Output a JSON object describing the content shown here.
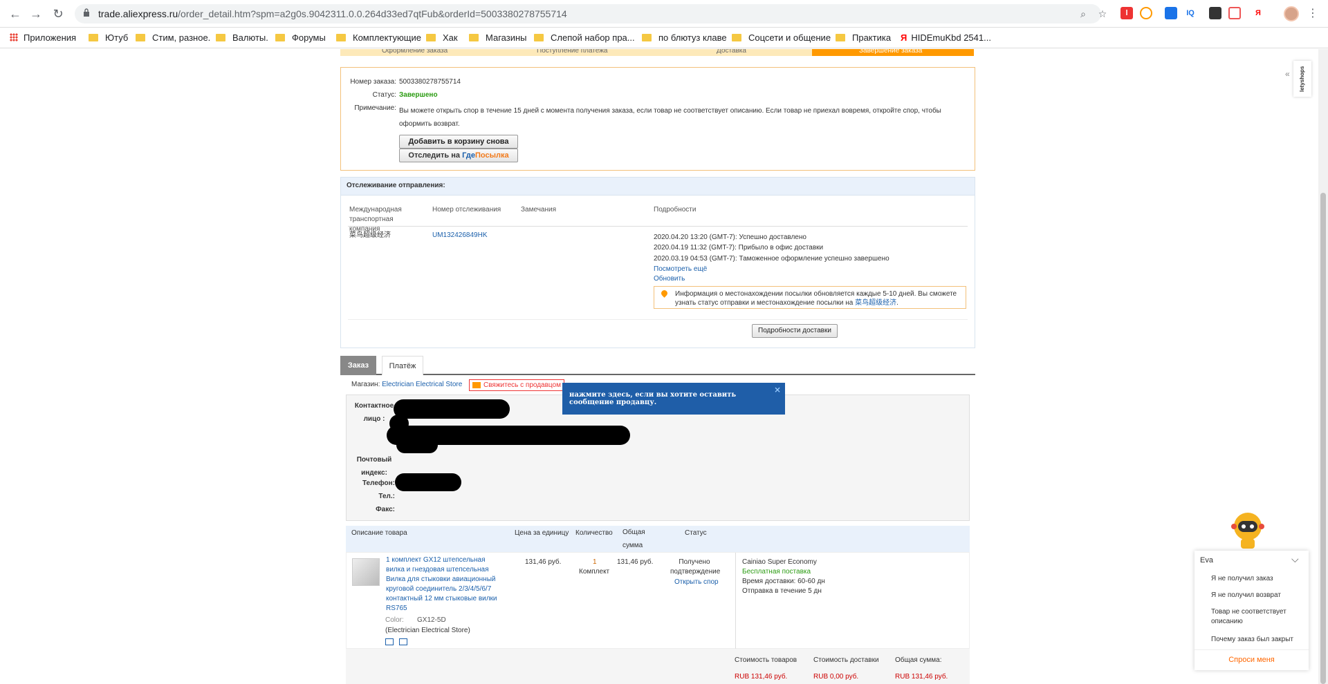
{
  "browser": {
    "url_host": "trade.aliexpress.ru",
    "url_path": "/order_detail.htm?spm=a2g0s.9042311.0.0.264d33ed7qtFub&orderId=5003380278755714",
    "bookmarks": [
      "Приложения",
      "Ютуб",
      "Стим, разное.",
      "Валюты.",
      "Форумы",
      "Комплектующие",
      "Хак",
      "Магазины",
      "Слепой набор пра...",
      "по блютуз клаве",
      "Соцсети и общение",
      "Практика",
      "HIDEmuKbd 2541..."
    ],
    "extensions": [
      "l",
      "IQ",
      "Я"
    ]
  },
  "steps": [
    "Оформление заказа",
    "Поступление платежа",
    "Доставка",
    "Завершение заказа"
  ],
  "order": {
    "number_label": "Номер заказа:",
    "number": "5003380278755714",
    "status_label": "Статус:",
    "status": "Завершено",
    "note_label": "Примечание:",
    "note": "Вы можете открыть спор в течение 15 дней с момента получения заказа, если товар не соответствует описанию. Если товар не приехал вовремя, откройте спор, чтобы оформить возврат.",
    "add_to_cart": "Добавить в корзину снова",
    "track_prefix": "Отследить на ",
    "track_gde": "Где",
    "track_posylka": "Посылка"
  },
  "tracking": {
    "title": "Отслеживание отправления:",
    "col_carrier": "Международная транспортная компания",
    "col_number": "Номер отслеживания",
    "col_notes": "Замечания",
    "col_details": "Подробности",
    "carrier": "菜鸟超级经济",
    "tracking_number": "UM132426849HK",
    "events": [
      "2020.04.20 13:20 (GMT-7): Успешно доставлено",
      "2020.04.19 11:32 (GMT-7): Прибыло в офис доставки",
      "2020.03.19 04:53 (GMT-7): Таможенное оформление успешно завершено"
    ],
    "see_more": "Посмотреть ещё",
    "refresh": "Обновить",
    "info_text": "Информация о местонахождении посылки обновляется каждые 5-10 дней. Вы сможете узнать статус отправки и местонахождение посылки на",
    "info_link": "菜鸟超级经济",
    "details_button": "Подробности доставки"
  },
  "tabs": [
    "Заказ",
    "Платёж"
  ],
  "shop": {
    "label": "Магазин:",
    "name": "Electrician Electrical Store",
    "contact": "Свяжитесь с продавцом",
    "tooltip": "нажмите здесь, если вы хотите оставить сообщение продавцу."
  },
  "address": {
    "contact_label": "Контактное лицо :",
    "zip_label": "Почтовый индекс:",
    "phone_label": "Телефон:",
    "tel_label": "Тел.:",
    "fax_label": "Факс:"
  },
  "products": {
    "headers": [
      "Описание товара",
      "Цена за единицу",
      "Количество",
      "Общая сумма",
      "Статус"
    ],
    "title": "1 комплект GX12 штепсельная вилка и гнездовая штепсельная Вилка для стыковки авиационный круговой соединитель 2/3/4/5/6/7 контактный 12 мм стыковые вилки RS765",
    "color_label": "Color:",
    "color_value": "GX12-5D",
    "store": "(Electrician Electrical Store)",
    "price": "131,46 руб.",
    "qty": "1",
    "qty_unit": "Комплект",
    "total": "131,46 руб.",
    "status": "Получено подтверждение",
    "dispute": "Открыть спор",
    "shipping_method": "Cainiao Super Economy",
    "free_shipping": "Бесплатная поставка",
    "delivery_time": "Время доставки: 60-60 дн",
    "dispatch": "Отправка в течение  5 дн"
  },
  "totals": {
    "goods_label": "Стоимость товаров",
    "shipping_label": "Стоимость доставки",
    "total_label": "Общая сумма:",
    "goods": "RUB 131,46 руб.",
    "shipping": "RUB 0,00 руб.",
    "total": "RUB 131,46 руб."
  },
  "eva": {
    "name": "Eva",
    "items": [
      "Я не получил заказ",
      "Я не получил возврат",
      "Товар не соответствует описанию",
      "Почему заказ был закрыт"
    ],
    "ask": "Спроси меня"
  },
  "colors": {
    "accent": "#ff9900",
    "link": "#1a5fab",
    "tooltip": "#1f5ea8"
  }
}
